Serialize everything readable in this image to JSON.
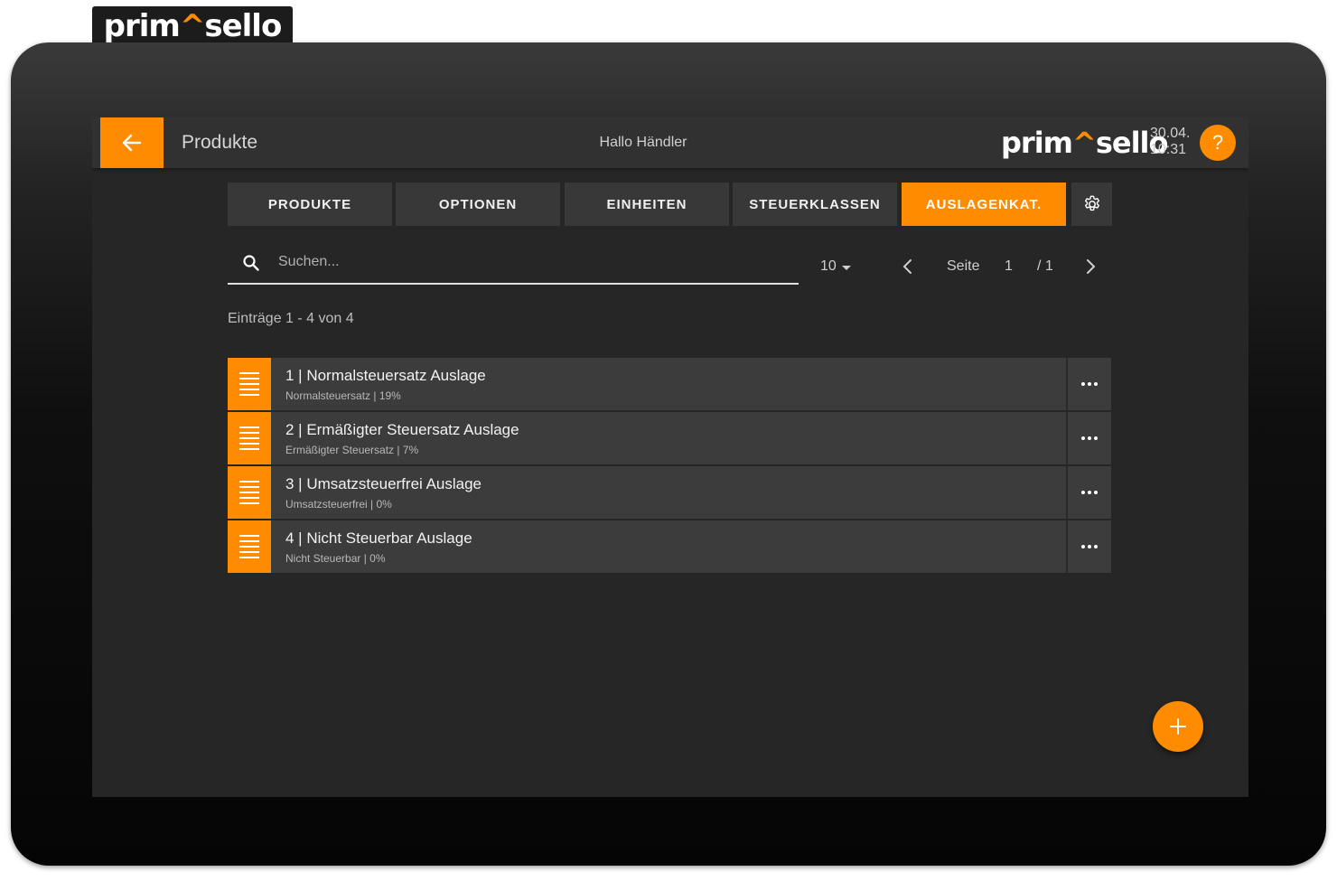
{
  "brand": {
    "logo_left": "prim",
    "logo_mark": "^",
    "logo_right": "sello"
  },
  "header": {
    "title": "Produkte",
    "greeting": "Hallo Händler",
    "date": "30.04.",
    "time": "10:31",
    "help_label": "?"
  },
  "tabs": [
    {
      "label": "PRODUKTE",
      "active": false
    },
    {
      "label": "OPTIONEN",
      "active": false
    },
    {
      "label": "EINHEITEN",
      "active": false
    },
    {
      "label": "STEUERKLASSEN",
      "active": false
    },
    {
      "label": "AUSLAGENKAT.",
      "active": true
    }
  ],
  "search": {
    "placeholder": "Suchen...",
    "value": ""
  },
  "pager": {
    "per_page": "10",
    "label": "Seite",
    "page": "1",
    "total": "/ 1"
  },
  "entries_info": "Einträge 1 - 4 von 4",
  "items": [
    {
      "title": "1 | Normalsteuersatz Auslage",
      "subtitle": "Normalsteuersatz | 19%"
    },
    {
      "title": "2 | Ermäßigter Steuersatz Auslage",
      "subtitle": "Ermäßigter Steuersatz | 7%"
    },
    {
      "title": "3 | Umsatzsteuerfrei Auslage",
      "subtitle": "Umsatzsteuerfrei | 0%"
    },
    {
      "title": "4 | Nicht Steuerbar Auslage",
      "subtitle": "Nicht Steuerbar | 0%"
    }
  ],
  "colors": {
    "accent": "#ff8c00",
    "background": "#262626",
    "header": "#313131"
  },
  "icons": {
    "back": "arrow-left-icon",
    "help": "question-icon",
    "settings": "gear-icon",
    "search": "search-icon",
    "drag": "drag-handle-icon",
    "more": "more-horizontal-icon",
    "add": "plus-icon"
  }
}
